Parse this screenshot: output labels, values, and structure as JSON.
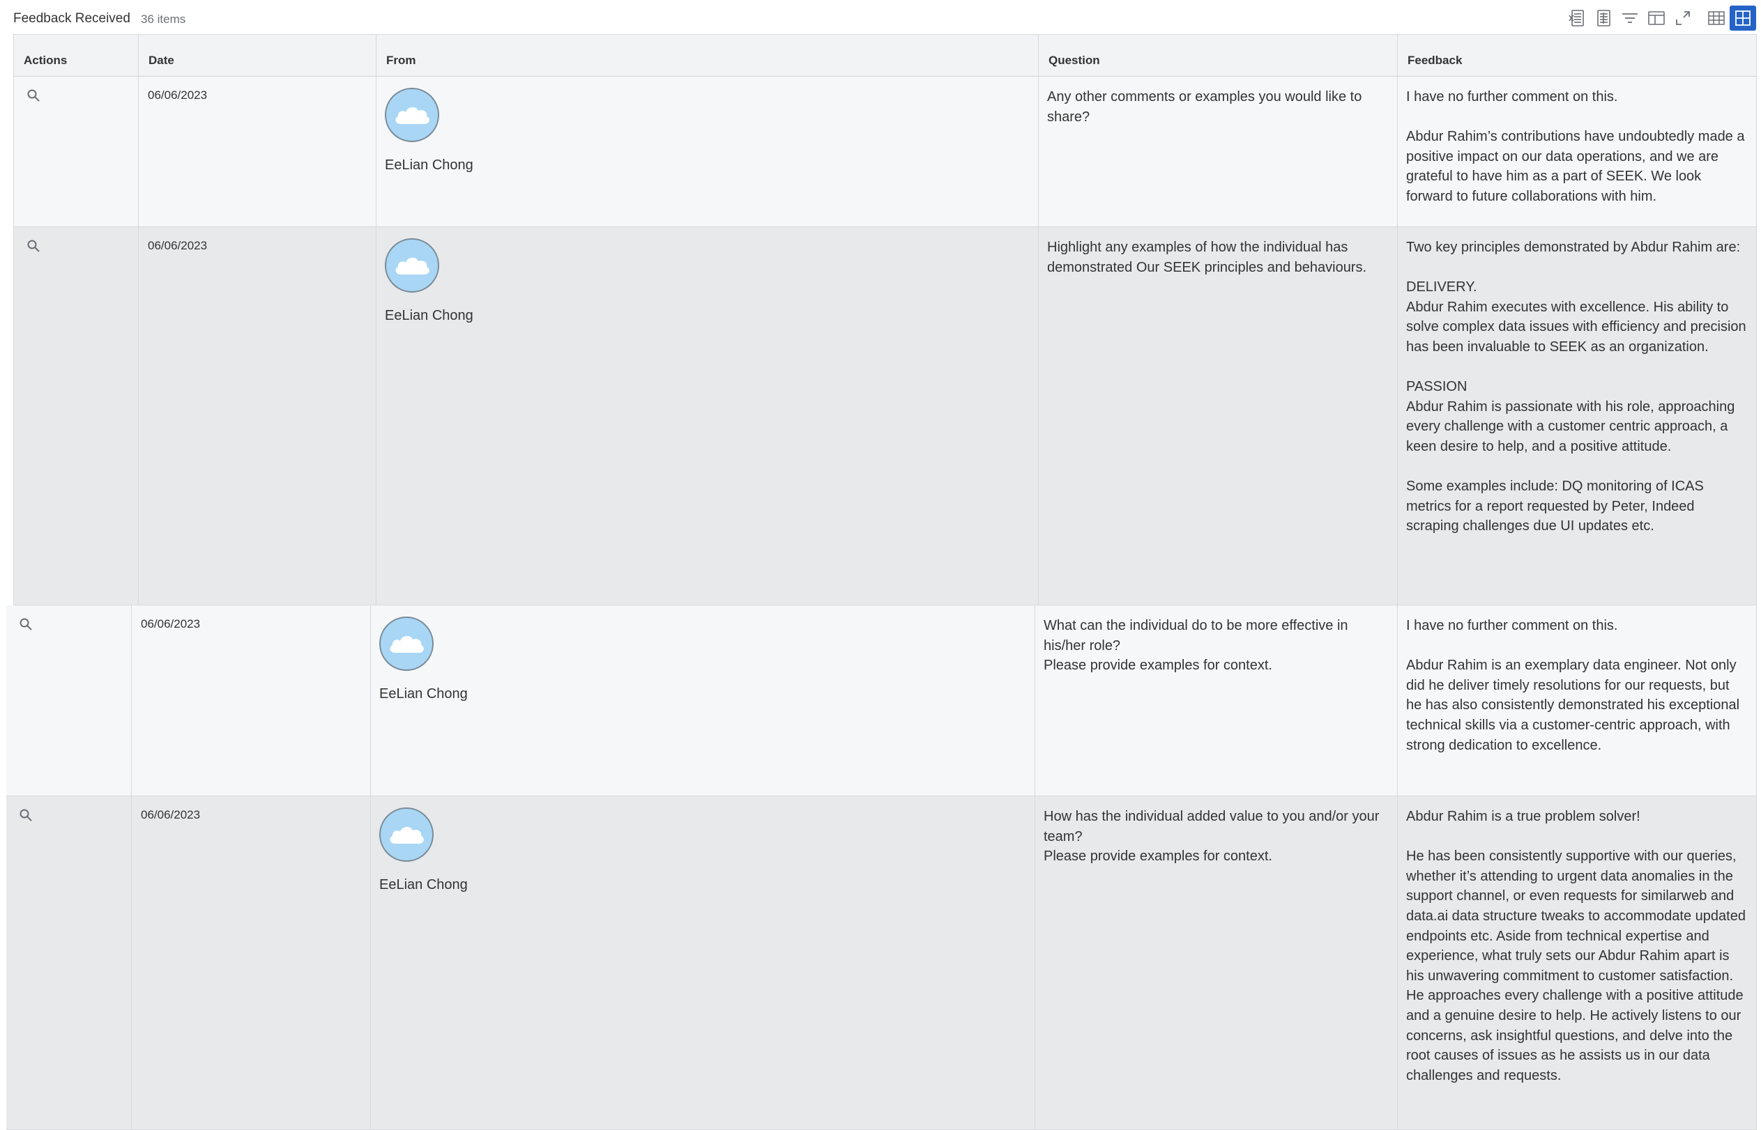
{
  "header": {
    "title": "Feedback Received",
    "count": "36 items"
  },
  "toolbar": {
    "icons": [
      "export-to-excel-icon",
      "export-to-pdf-icon",
      "filter-icon",
      "column-layout-icon",
      "fullscreen-icon"
    ],
    "views": [
      "table-view-icon",
      "grid-view-icon"
    ],
    "active_view": "grid-view-icon"
  },
  "columns": {
    "actions": "Actions",
    "date": "Date",
    "from": "From",
    "question": "Question",
    "feedback": "Feedback"
  },
  "rows": [
    {
      "date": "06/06/2023",
      "from": "EeLian Chong",
      "question": "Any other comments or examples you would like to share?",
      "feedback": "I have no further comment on this.\n\nAbdur Rahim’s contributions have undoubtedly made a positive impact on our data operations, and we are grateful to have him as a part of SEEK. We look forward to future collaborations with him."
    },
    {
      "date": "06/06/2023",
      "from": "EeLian Chong",
      "question": "Highlight any examples of how the individual has demonstrated Our SEEK principles and behaviours.",
      "feedback": "Two key principles demonstrated by Abdur Rahim are:\n\nDELIVERY.\nAbdur Rahim executes with excellence. His ability to solve complex data issues with efficiency and precision has been invaluable to SEEK as an organization.\n\nPASSION\nAbdur Rahim is passionate with his role, approaching every challenge with a customer centric approach, a keen desire to help, and a positive attitude.\n\nSome examples include: DQ monitoring of ICAS metrics for a report requested by Peter, Indeed scraping challenges due UI updates etc."
    },
    {
      "date": "06/06/2023",
      "from": "EeLian Chong",
      "question": "What can the individual do to be more effective in his/her role?\nPlease provide examples for context.",
      "feedback": "I have no further comment on this.\n\nAbdur Rahim is an exemplary data engineer. Not only did he deliver timely resolutions for our requests, but he has also consistently demonstrated his exceptional technical skills via a customer-centric approach, with strong dedication to excellence."
    },
    {
      "date": "06/06/2023",
      "from": "EeLian Chong",
      "question": "How has the individual added value to you and/or your team?\nPlease provide examples for context.",
      "feedback": "Abdur Rahim is a true problem solver!\n\nHe has been consistently supportive with our queries, whether it’s attending to urgent data anomalies in the support channel, or even requests for similarweb and data.ai data structure tweaks to accommodate updated endpoints etc. Aside from technical expertise and experience, what truly sets our Abdur Rahim apart is his unwavering commitment to customer satisfaction. He approaches every challenge with a positive attitude and a genuine desire to help. He actively listens to our concerns, ask insightful questions, and delve into the root causes of issues as he assists us in our data challenges and requests."
    }
  ]
}
